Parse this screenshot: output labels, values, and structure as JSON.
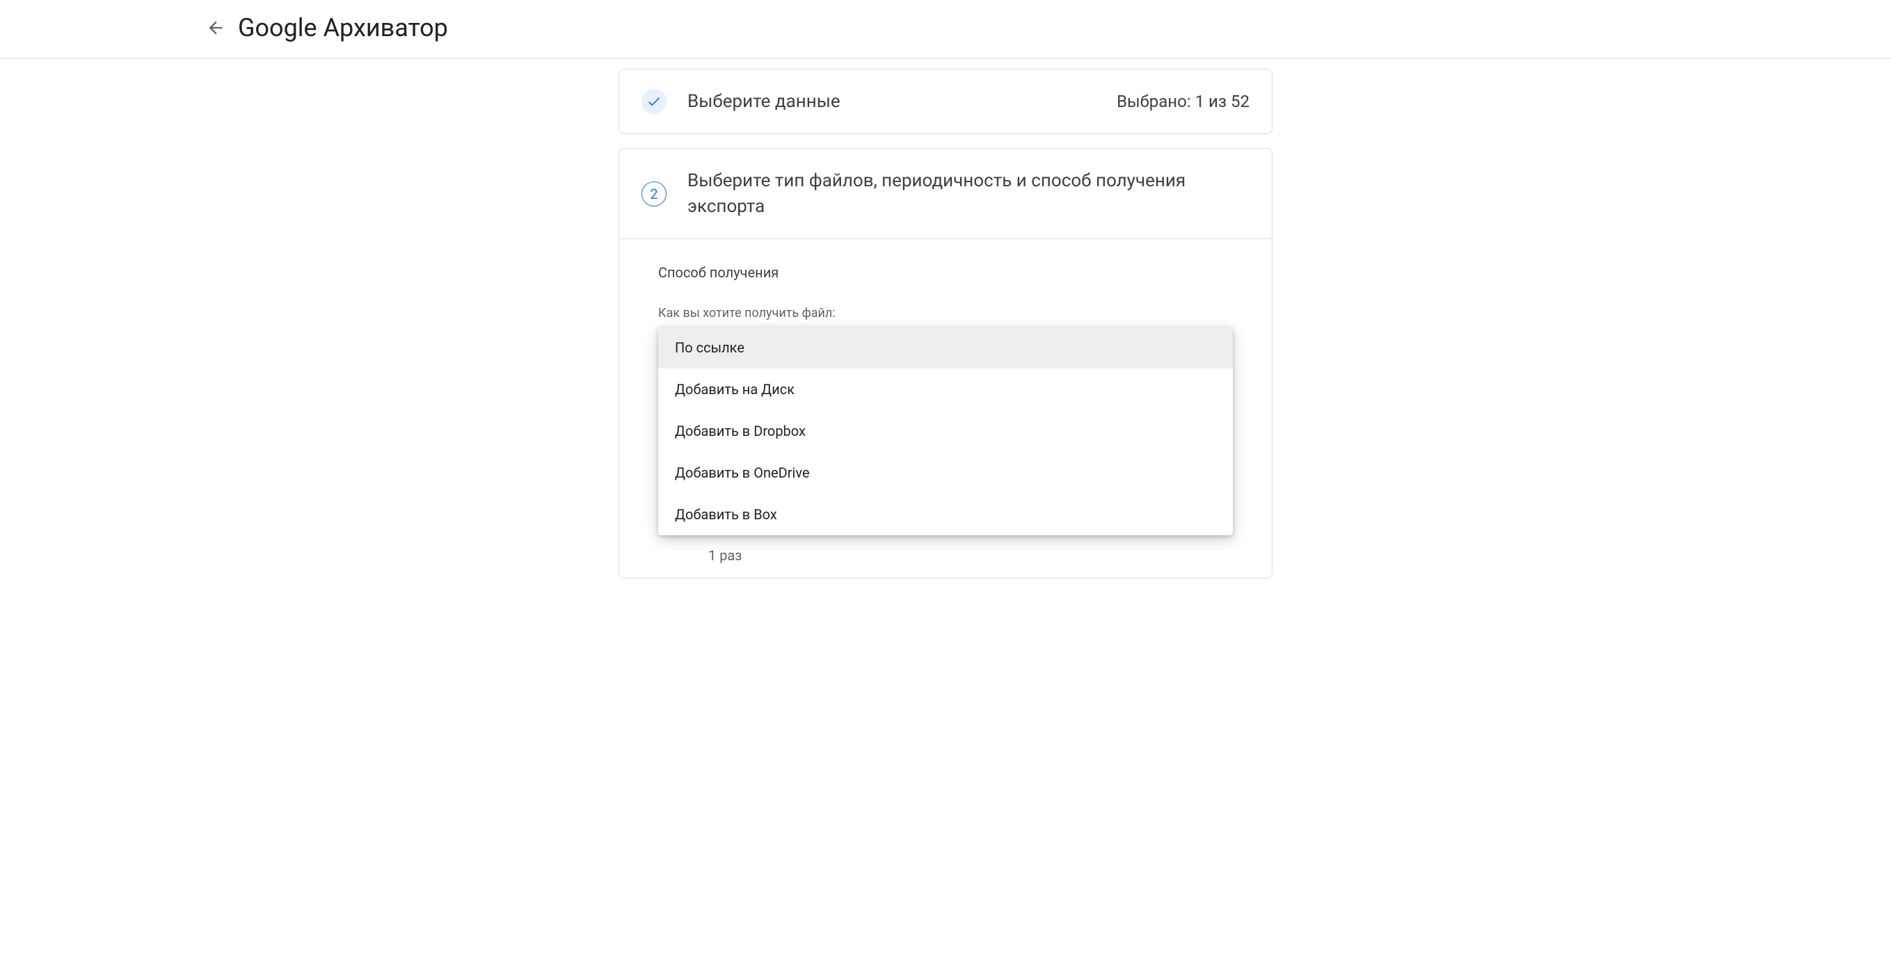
{
  "header": {
    "title": "Google Архиватор"
  },
  "step1": {
    "title": "Выберите данные",
    "summary": "Выбрано: 1 из 52"
  },
  "step2": {
    "number": "2",
    "title": "Выберите тип файлов, периодичность и способ получения экспорта",
    "sectionTitle": "Способ получения",
    "fieldLabel": "Как вы хотите получить файл:",
    "options": [
      "По ссылке",
      "Добавить на Диск",
      "Добавить в Dropbox",
      "Добавить в OneDrive",
      "Добавить в Box"
    ],
    "radio": {
      "sub": "1 раз"
    }
  }
}
